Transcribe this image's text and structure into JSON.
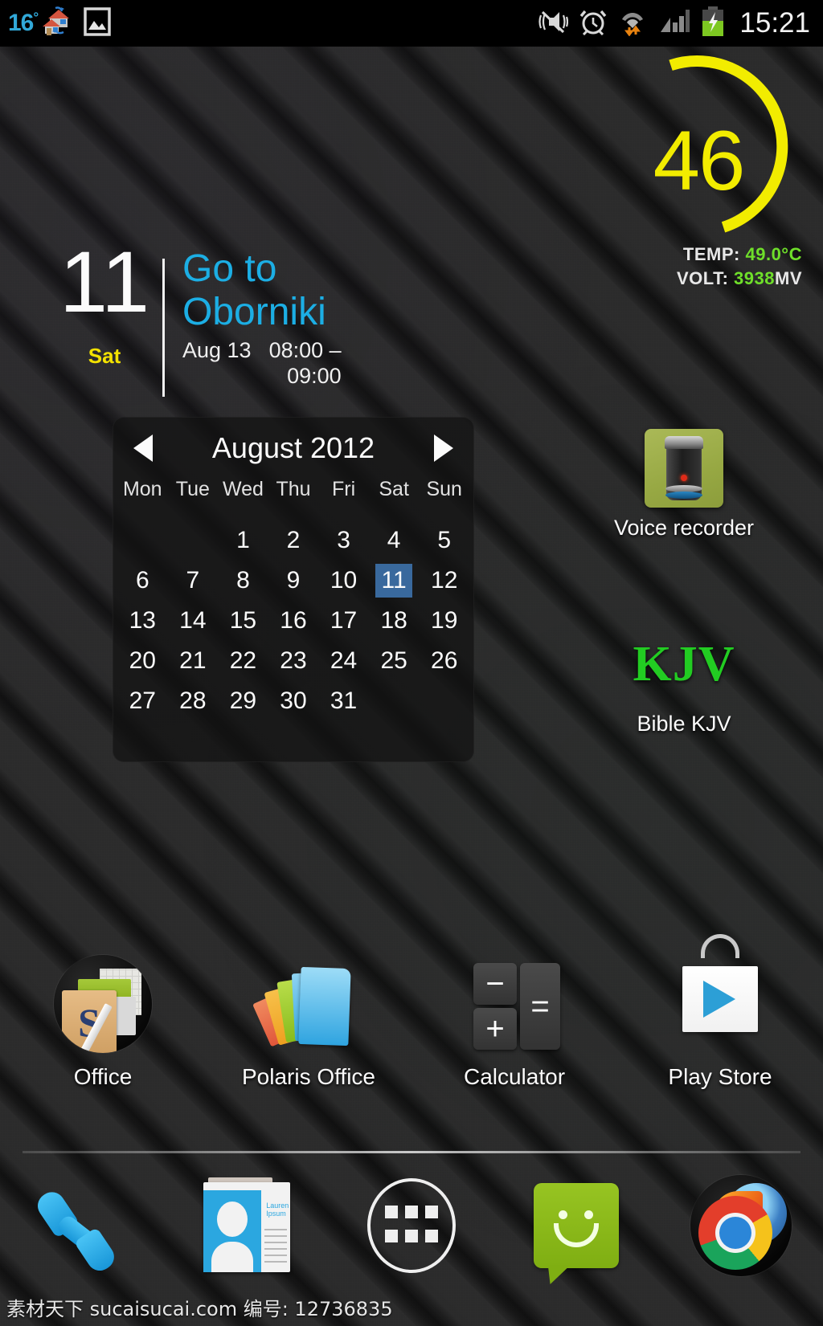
{
  "statusbar": {
    "temperature": "16",
    "degree_symbol": "°",
    "icons_left": [
      "home-sync-icon",
      "gallery-image-icon"
    ],
    "icons_right": [
      "vibrate-mute-icon",
      "alarm-icon",
      "wifi-transfer-icon",
      "signal-icon",
      "battery-charging-icon"
    ],
    "clock": "15:21"
  },
  "battery_widget": {
    "percent": "46",
    "arc_color": "#f2ec00",
    "temp_label": "TEMP:",
    "temp_value": "49.0°C",
    "volt_label": "VOLT:",
    "volt_value": "3938",
    "volt_unit": "MV",
    "value_color": "#6fdf2a"
  },
  "event_widget": {
    "day_number": "11",
    "day_of_week": "Sat",
    "title": "Go to Oborniki",
    "date": "Aug 13",
    "time_start": "08:00 –",
    "time_end": "09:00",
    "title_color": "#1caee4",
    "dow_color": "#f3e200"
  },
  "calendar_widget": {
    "month_title": "August 2012",
    "prev_label": "prev-month",
    "next_label": "next-month",
    "day_headers": [
      "Mon",
      "Tue",
      "Wed",
      "Thu",
      "Fri",
      "Sat",
      "Sun"
    ],
    "leading_blanks": 2,
    "days": [
      1,
      2,
      3,
      4,
      5,
      6,
      7,
      8,
      9,
      10,
      11,
      12,
      13,
      14,
      15,
      16,
      17,
      18,
      19,
      20,
      21,
      22,
      23,
      24,
      25,
      26,
      27,
      28,
      29,
      30,
      31
    ],
    "today": 11,
    "today_highlight_color": "#39699d"
  },
  "side_shortcuts": [
    {
      "label": "Voice recorder",
      "icon": "voice-recorder-icon"
    },
    {
      "label": "Bible KJV",
      "icon": "kjv-icon",
      "icon_text": "KJV",
      "icon_color": "#22cc22"
    }
  ],
  "app_row": [
    {
      "label": "Office",
      "icon": "office-app-icon"
    },
    {
      "label": "Polaris Office",
      "icon": "polaris-office-icon"
    },
    {
      "label": "Calculator",
      "icon": "calculator-icon",
      "keys": [
        "−",
        "+",
        "="
      ]
    },
    {
      "label": "Play Store",
      "icon": "play-store-icon"
    }
  ],
  "dock": [
    {
      "name": "phone",
      "icon": "phone-icon"
    },
    {
      "name": "contacts",
      "icon": "contacts-icon",
      "card_text": "Lauren Ipsum"
    },
    {
      "name": "app-drawer",
      "icon": "app-drawer-icon"
    },
    {
      "name": "messaging",
      "icon": "messaging-icon"
    },
    {
      "name": "browser-folder",
      "icon": "browser-folder-icon"
    }
  ],
  "watermark": "素材天下 sucaisucai.com 编号: 12736835"
}
